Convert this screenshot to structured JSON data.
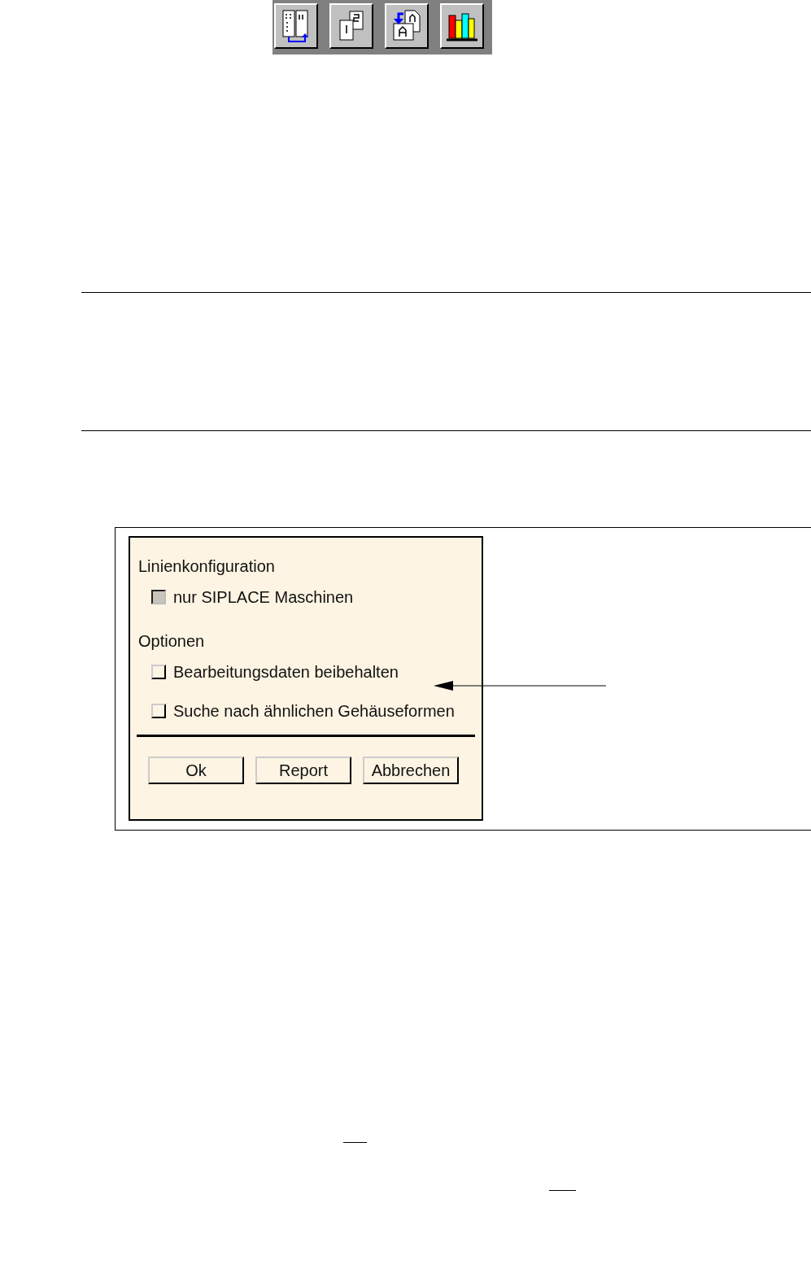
{
  "toolbar": {
    "buttons": [
      {
        "kind": "columns"
      },
      {
        "kind": "pages"
      },
      {
        "kind": "swap"
      },
      {
        "kind": "books"
      }
    ]
  },
  "dialog": {
    "sections": [
      {
        "heading": "Linienkonfiguration",
        "options": [
          {
            "label": "nur SIPLACE Maschinen",
            "checked": false,
            "disabled": true
          }
        ]
      },
      {
        "heading": "Optionen",
        "options": [
          {
            "label": "Bearbeitungsdaten beibehalten",
            "checked": false,
            "disabled": false
          },
          {
            "label": "Suche nach ähnlichen Gehäuseformen",
            "checked": false,
            "disabled": false
          }
        ]
      }
    ],
    "buttons": [
      "Ok",
      "Report",
      "Abbrechen"
    ]
  }
}
